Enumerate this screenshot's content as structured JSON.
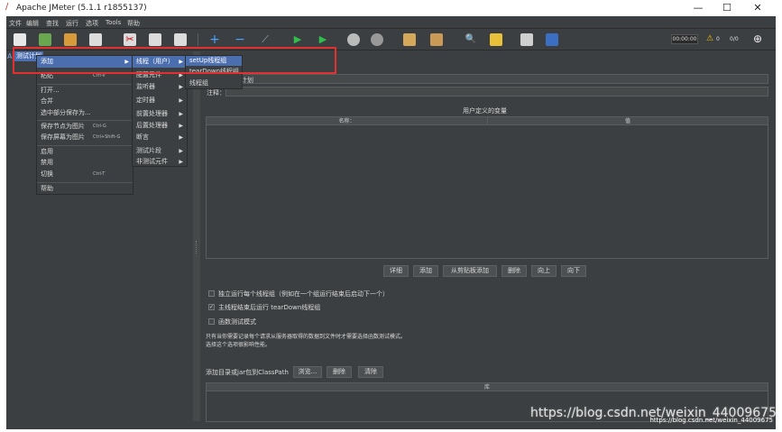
{
  "window": {
    "title": "Apache JMeter (5.1.1 r1855137)",
    "minimize": "—",
    "maximize": "☐",
    "close": "✕"
  },
  "menubar": {
    "items": [
      "文件",
      "编辑",
      "查找",
      "运行",
      "选项",
      "Tools",
      "帮助"
    ]
  },
  "toolbar": {
    "timer": "00:00:00",
    "warnings": "0",
    "threads": "0/0"
  },
  "tree": {
    "root_label": "测试计划"
  },
  "context_menu": {
    "items": [
      {
        "label": "添加",
        "shortcut": "",
        "submenu": true,
        "highlighted": true
      },
      {
        "label": "粘贴",
        "shortcut": "Ctrl-V",
        "submenu": false
      },
      {
        "label": "打开...",
        "shortcut": "",
        "submenu": false
      },
      {
        "label": "合并",
        "shortcut": "",
        "submenu": false
      },
      {
        "label": "选中部分保存为...",
        "shortcut": "",
        "submenu": false
      },
      {
        "label": "保存节点为图片",
        "shortcut": "Ctrl-G",
        "submenu": false
      },
      {
        "label": "保存屏幕为图片",
        "shortcut": "Ctrl+Shift-G",
        "submenu": false
      },
      {
        "label": "启用",
        "shortcut": "",
        "submenu": false
      },
      {
        "label": "禁用",
        "shortcut": "",
        "submenu": false
      },
      {
        "label": "切换",
        "shortcut": "Ctrl-T",
        "submenu": false
      },
      {
        "label": "帮助",
        "shortcut": "",
        "submenu": false
      }
    ]
  },
  "submenu_add": {
    "items": [
      {
        "label": "线程（用户）",
        "highlighted": true
      },
      {
        "label": "配置元件"
      },
      {
        "label": "监听器"
      },
      {
        "label": "定时器"
      },
      {
        "label": "前置处理器"
      },
      {
        "label": "后置处理器"
      },
      {
        "label": "断言"
      },
      {
        "label": "测试片段"
      },
      {
        "label": "非测试元件"
      }
    ]
  },
  "submenu_threads": {
    "items": [
      {
        "label": "setUp线程组",
        "highlighted": true
      },
      {
        "label": "tearDown线程组"
      },
      {
        "label": "线程组"
      }
    ]
  },
  "content": {
    "name_value": "计划",
    "comment_label": "注释：",
    "variables_title": "用户定义的变量",
    "col_name": "名称：",
    "col_value": "值",
    "buttons": [
      "详细",
      "添加",
      "从剪贴板添加",
      "删除",
      "向上",
      "向下"
    ],
    "check1": "独立运行每个线程组（例如在一个组运行结束后启动下一个）",
    "check2": "主线程结束后运行 tearDown线程组",
    "check3": "函数测试模式",
    "note_line1": "只有当你需要记录每个请求从服务器取得的数据到文件时才需要选择函数测试模式。",
    "note_line2": "选择这个选项很影响性能。",
    "classpath_label": "添加目录或jar包到ClassPath",
    "classpath_buttons": [
      "浏览...",
      "删除",
      "清除"
    ],
    "lib_col": "库"
  },
  "watermark": {
    "main": "https://blog.csdn.net/weixin_44009675",
    "small": "https://blog.csdn.net/weixin_44009675"
  },
  "colors": {
    "bg": "#3c3f41",
    "highlight": "#4b6eaf",
    "annotation": "#e03030"
  }
}
